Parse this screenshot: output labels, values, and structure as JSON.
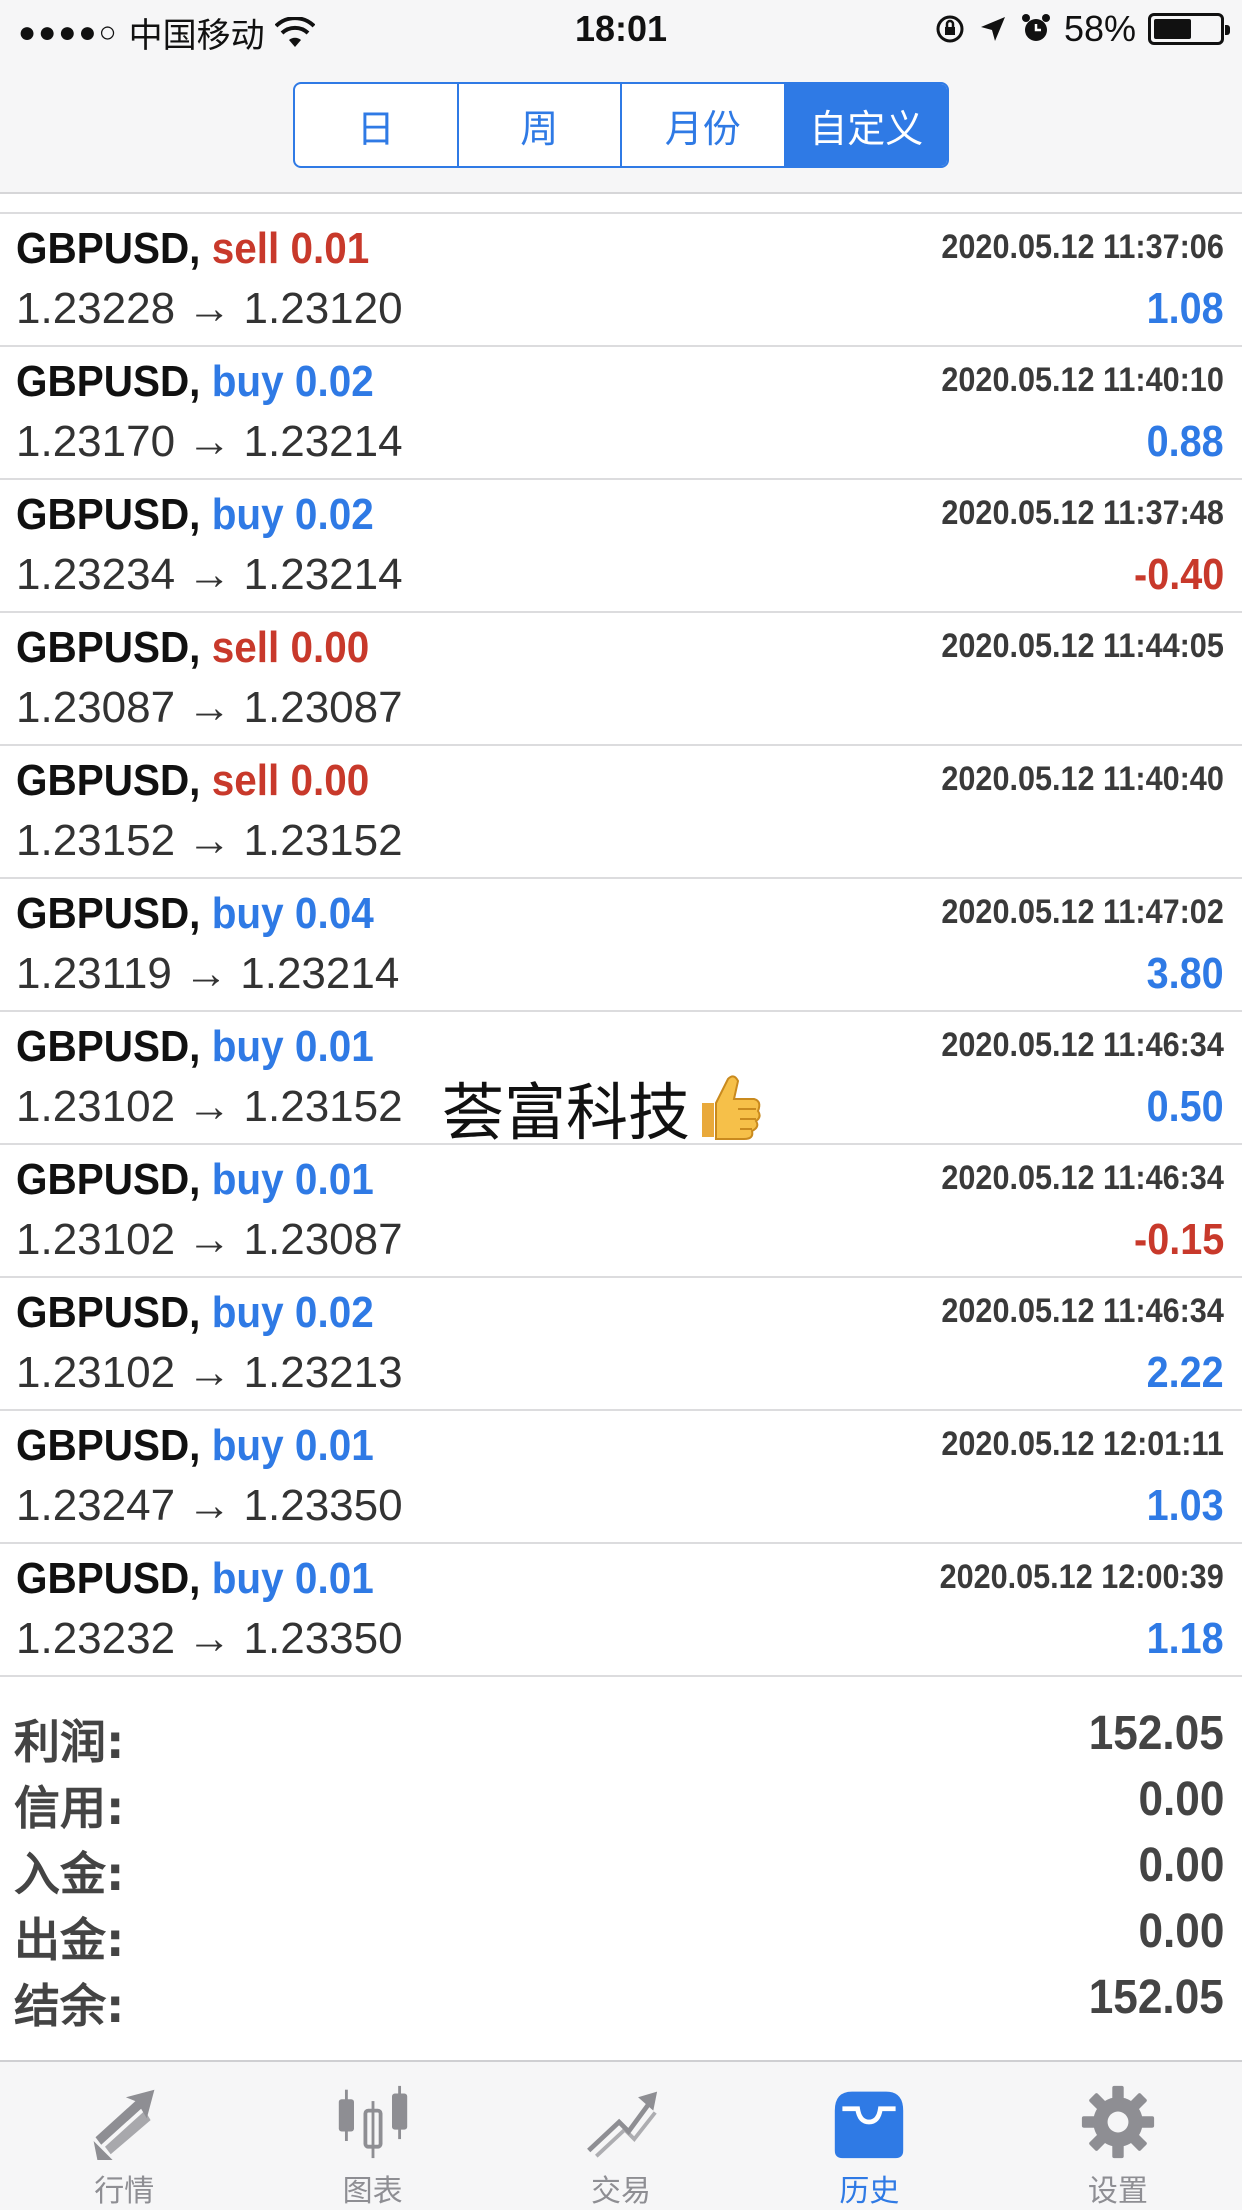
{
  "status_bar": {
    "signal": "●●●●○",
    "carrier": "中国移动",
    "time": "18:01",
    "battery": "58%",
    "battery_level": 0.58
  },
  "nav": {
    "segments": [
      {
        "label": "日",
        "active": false
      },
      {
        "label": "周",
        "active": false
      },
      {
        "label": "月份",
        "active": false
      },
      {
        "label": "自定义",
        "active": true
      }
    ]
  },
  "deals": [
    {
      "symbol": "GBPUSD,",
      "type": "sell",
      "volume": "0.01",
      "time": "2020.05.12 11:37:06",
      "open": "1.23228",
      "arrow": "→",
      "close": "1.23120",
      "profit": "1.08",
      "sign": "pos"
    },
    {
      "symbol": "GBPUSD,",
      "type": "buy",
      "volume": "0.02",
      "time": "2020.05.12 11:40:10",
      "open": "1.23170",
      "arrow": "→",
      "close": "1.23214",
      "profit": "0.88",
      "sign": "pos"
    },
    {
      "symbol": "GBPUSD,",
      "type": "buy",
      "volume": "0.02",
      "time": "2020.05.12 11:37:48",
      "open": "1.23234",
      "arrow": "→",
      "close": "1.23214",
      "profit": "-0.40",
      "sign": "neg"
    },
    {
      "symbol": "GBPUSD,",
      "type": "sell",
      "volume": "0.00",
      "time": "2020.05.12 11:44:05",
      "open": "1.23087",
      "arrow": "→",
      "close": "1.23087",
      "profit": "",
      "sign": "pos"
    },
    {
      "symbol": "GBPUSD,",
      "type": "sell",
      "volume": "0.00",
      "time": "2020.05.12 11:40:40",
      "open": "1.23152",
      "arrow": "→",
      "close": "1.23152",
      "profit": "",
      "sign": "pos"
    },
    {
      "symbol": "GBPUSD,",
      "type": "buy",
      "volume": "0.04",
      "time": "2020.05.12 11:47:02",
      "open": "1.23119",
      "arrow": "→",
      "close": "1.23214",
      "profit": "3.80",
      "sign": "pos"
    },
    {
      "symbol": "GBPUSD,",
      "type": "buy",
      "volume": "0.01",
      "time": "2020.05.12 11:46:34",
      "open": "1.23102",
      "arrow": "→",
      "close": "1.23152",
      "profit": "0.50",
      "sign": "pos"
    },
    {
      "symbol": "GBPUSD,",
      "type": "buy",
      "volume": "0.01",
      "time": "2020.05.12 11:46:34",
      "open": "1.23102",
      "arrow": "→",
      "close": "1.23087",
      "profit": "-0.15",
      "sign": "neg"
    },
    {
      "symbol": "GBPUSD,",
      "type": "buy",
      "volume": "0.02",
      "time": "2020.05.12 11:46:34",
      "open": "1.23102",
      "arrow": "→",
      "close": "1.23213",
      "profit": "2.22",
      "sign": "pos"
    },
    {
      "symbol": "GBPUSD,",
      "type": "buy",
      "volume": "0.01",
      "time": "2020.05.12 12:01:11",
      "open": "1.23247",
      "arrow": "→",
      "close": "1.23350",
      "profit": "1.03",
      "sign": "pos"
    },
    {
      "symbol": "GBPUSD,",
      "type": "buy",
      "volume": "0.01",
      "time": "2020.05.12 12:00:39",
      "open": "1.23232",
      "arrow": "→",
      "close": "1.23350",
      "profit": "1.18",
      "sign": "pos"
    }
  ],
  "summary": [
    {
      "label": "利润:",
      "value": "152.05"
    },
    {
      "label": "信用:",
      "value": "0.00"
    },
    {
      "label": "入金:",
      "value": "0.00"
    },
    {
      "label": "出金:",
      "value": "0.00"
    },
    {
      "label": "结余:",
      "value": "152.05"
    }
  ],
  "watermark": {
    "text": "荟富科技",
    "emoji": "thumbs-up-icon"
  },
  "tabs": [
    {
      "label": "行情",
      "icon": "quotes-icon",
      "active": false
    },
    {
      "label": "图表",
      "icon": "chart-icon",
      "active": false
    },
    {
      "label": "交易",
      "icon": "trade-icon",
      "active": false
    },
    {
      "label": "历史",
      "icon": "history-icon",
      "active": true
    },
    {
      "label": "设置",
      "icon": "settings-icon",
      "active": false
    }
  ],
  "colors": {
    "accent": "#2f7ae5",
    "sell": "#c8392b",
    "loss": "#c8392b",
    "inactive_tab": "#8e8e93"
  }
}
